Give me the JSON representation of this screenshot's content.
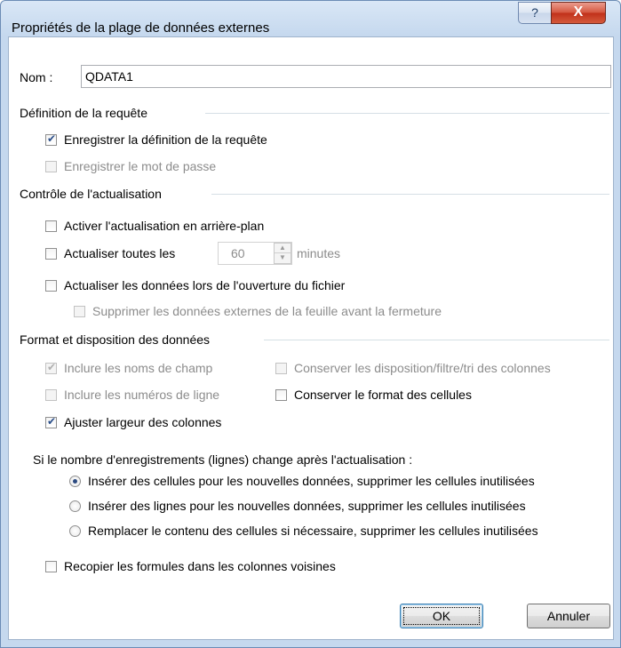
{
  "window": {
    "title": "Propriétés de la plage de données externes",
    "help_glyph": "?",
    "close_glyph": "X"
  },
  "name_field": {
    "label": "Nom :",
    "value": "QDATA1"
  },
  "query_definition": {
    "heading": "Définition de la requête",
    "save_query": {
      "label": "Enregistrer la définition de la requête",
      "checked": true,
      "enabled": true
    },
    "save_password": {
      "label": "Enregistrer le mot de passe",
      "checked": false,
      "enabled": false
    }
  },
  "refresh_control": {
    "heading": "Contrôle de l'actualisation",
    "background_refresh": {
      "label": "Activer l'actualisation en arrière-plan",
      "checked": false
    },
    "refresh_every": {
      "label": "Actualiser toutes les",
      "value": "60",
      "unit": "minutes",
      "checked": false
    },
    "refresh_on_open": {
      "label": "Actualiser les données lors de l'ouverture du fichier",
      "checked": false
    },
    "remove_before_close": {
      "label": "Supprimer les données externes de la feuille avant la fermeture",
      "checked": false,
      "enabled": false
    }
  },
  "data_format": {
    "heading": "Format et disposition des données",
    "include_field_names": {
      "label": "Inclure les noms de champ",
      "checked": true,
      "enabled": false
    },
    "include_row_numbers": {
      "label": "Inclure les numéros de ligne",
      "checked": false,
      "enabled": false
    },
    "adjust_column_width": {
      "label": "Ajuster largeur des colonnes",
      "checked": true
    },
    "preserve_column_sort": {
      "label": "Conserver les disposition/filtre/tri des colonnes",
      "checked": false,
      "enabled": false
    },
    "preserve_cell_format": {
      "label": "Conserver le format des cellules",
      "checked": false
    },
    "row_change_prompt": "Si le nombre d'enregistrements (lignes) change après l'actualisation :",
    "options": [
      {
        "label": "Insérer des cellules pour les nouvelles données, supprimer les cellules inutilisées",
        "selected": true
      },
      {
        "label": "Insérer des lignes pour les nouvelles données, supprimer les cellules inutilisées",
        "selected": false
      },
      {
        "label": "Remplacer le contenu des cellules si nécessaire, supprimer les cellules inutilisées",
        "selected": false
      }
    ],
    "fill_down_formulas": {
      "label": "Recopier les formules dans les colonnes voisines",
      "checked": false
    }
  },
  "buttons": {
    "ok": "OK",
    "cancel": "Annuler"
  }
}
